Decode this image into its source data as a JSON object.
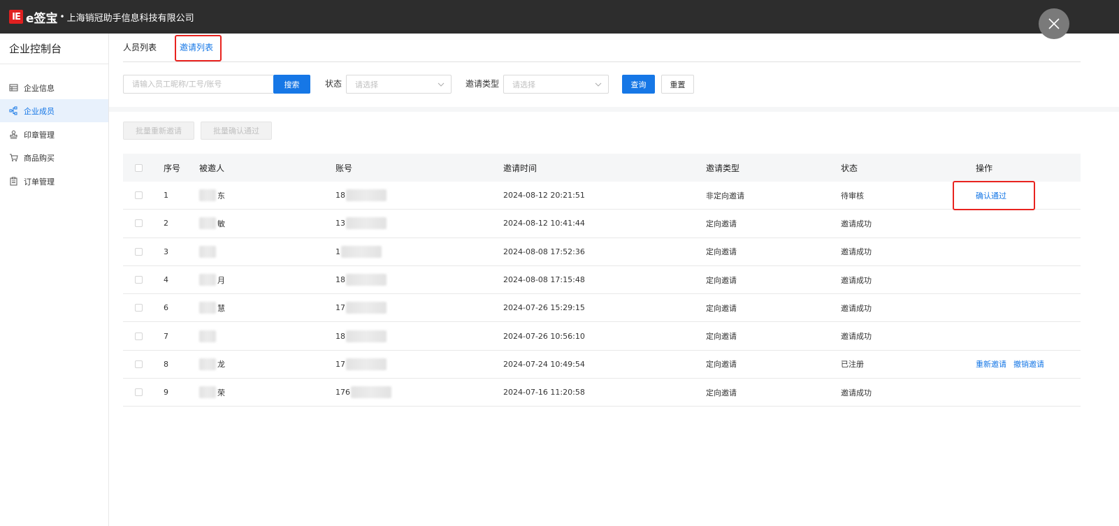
{
  "header": {
    "logo_text": "IE",
    "brand": "e签宝",
    "dot": "•",
    "company": "上海销冠助手信息科技有限公司"
  },
  "sidebar": {
    "title": "企业控制台",
    "items": [
      {
        "label": "企业信息",
        "icon": "table-icon"
      },
      {
        "label": "企业成员",
        "icon": "org-chart-icon"
      },
      {
        "label": "印章管理",
        "icon": "stamp-icon"
      },
      {
        "label": "商品购买",
        "icon": "cart-icon"
      },
      {
        "label": "订单管理",
        "icon": "clipboard-icon"
      }
    ],
    "active_item": "企业成员"
  },
  "tabs": [
    {
      "label": "人员列表",
      "active": false
    },
    {
      "label": "邀请列表",
      "active": true
    }
  ],
  "filters": {
    "search_placeholder": "请输入员工昵称/工号/账号",
    "search_button": "搜索",
    "status_label": "状态",
    "status_placeholder": "请选择",
    "invite_type_label": "邀请类型",
    "invite_type_placeholder": "请选择",
    "query_button": "查询",
    "reset_button": "重置"
  },
  "batch_actions": {
    "reinvite": "批量重新邀请",
    "confirm": "批量确认通过"
  },
  "table": {
    "columns": [
      "序号",
      "被邀人",
      "账号",
      "邀请时间",
      "邀请类型",
      "状态",
      "操作"
    ],
    "rows": [
      {
        "no": "1",
        "name": "东",
        "account": "18",
        "time": "2024-08-12 20:21:51",
        "type": "非定向邀请",
        "status": "待审核",
        "actions": [
          "确认通过"
        ]
      },
      {
        "no": "2",
        "name": "敏",
        "account": "13",
        "time": "2024-08-12 10:41:44",
        "type": "定向邀请",
        "status": "邀请成功",
        "actions": []
      },
      {
        "no": "3",
        "name": "",
        "account": "1",
        "time": "2024-08-08 17:52:36",
        "type": "定向邀请",
        "status": "邀请成功",
        "actions": []
      },
      {
        "no": "4",
        "name": "月",
        "account": "18",
        "time": "2024-08-08 17:15:48",
        "type": "定向邀请",
        "status": "邀请成功",
        "actions": []
      },
      {
        "no": "6",
        "name": "慧",
        "account": "17",
        "time": "2024-07-26 15:29:15",
        "type": "定向邀请",
        "status": "邀请成功",
        "actions": []
      },
      {
        "no": "7",
        "name": "",
        "account": "18",
        "time": "2024-07-26 10:56:10",
        "type": "定向邀请",
        "status": "邀请成功",
        "actions": []
      },
      {
        "no": "8",
        "name": "龙",
        "account": "17",
        "time": "2024-07-24 10:49:54",
        "type": "定向邀请",
        "status": "已注册",
        "actions": [
          "重新邀请",
          "撤销邀请"
        ]
      },
      {
        "no": "9",
        "name": "荣",
        "account": "176",
        "time": "2024-07-16 11:20:58",
        "type": "定向邀请",
        "status": "邀请成功",
        "actions": []
      }
    ]
  },
  "colors": {
    "accent": "#1677e6",
    "highlight": "#e8231f",
    "topbar": "#2d2d2d"
  }
}
